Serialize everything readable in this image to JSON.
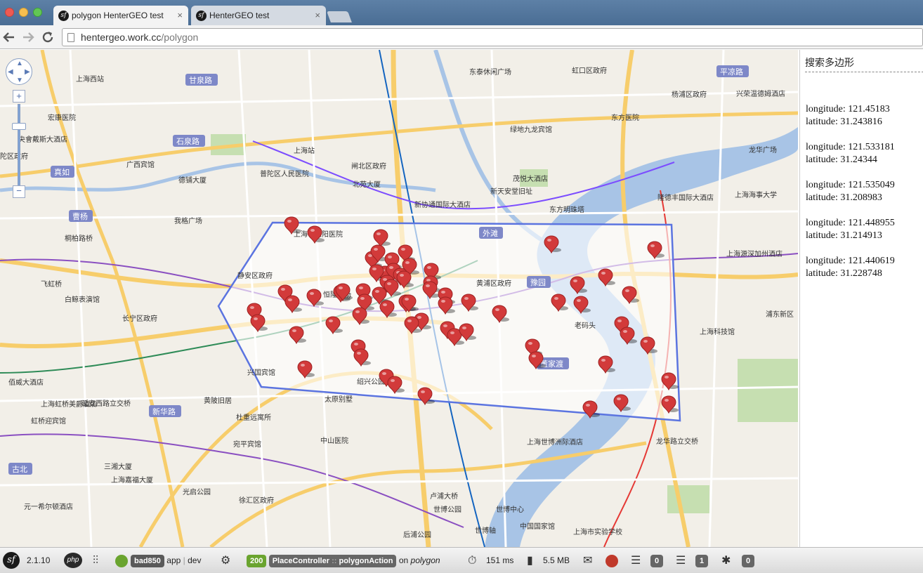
{
  "browser": {
    "tabs": [
      {
        "title": "polygon HenterGEO test",
        "active": true
      },
      {
        "title": "HenterGEO test",
        "active": false
      }
    ],
    "url_host": "hentergeo.work.cc",
    "url_path": "/polygon",
    "tab_favicon_glyph": "sf",
    "tab_close_glyph": "×"
  },
  "map": {
    "road_labels": [
      "甘泉路",
      "石泉路",
      "真如",
      "曹杨",
      "古北",
      "新华路",
      "平凉路",
      "外滩",
      "豫园",
      "董家渡"
    ],
    "place_labels": [
      "上海西站",
      "宏康医院",
      "央會戴斯大酒店",
      "陀区政府",
      "广西宾馆",
      "德铺大厦",
      "普陀区人民医院",
      "上海站",
      "闸北区政府",
      "北苑大厦",
      "东泰休闲广场",
      "虹口区政府",
      "杨浦区政府",
      "兴荣温德姆酒店",
      "绿地九龙宾馆",
      "茂悦大酒店",
      "新天安堂旧址",
      "东方明珠塔",
      "新协通国际大酒店",
      "我格广场",
      "桐柏路桥",
      "上海市江阳医院",
      "静安区政府",
      "长宁区政府",
      "飞虹桥",
      "白鲸表演馆",
      "恒隆广场",
      "兴国宾馆",
      "黄浦区政府",
      "豫园",
      "老码头",
      "绍兴公园",
      "黄陂旧居",
      "太原别墅",
      "杜重远寓所",
      "中山医院",
      "宛平宾馆",
      "三湘大厦",
      "上海嘉福大厦",
      "光启公园",
      "徐汇区政府",
      "元一希尔顿酒店",
      "卢浦大桥",
      "世博公园",
      "世博中心",
      "中国国家馆",
      "世博轴",
      "上海市实验学校",
      "龙华路立交桥",
      "延安西路立交桥",
      "上海虹桥美爵酒店",
      "虹桥迎宾馆",
      "佰威大酒店",
      "隆德丰国际大酒店",
      "上海海事大学",
      "上海源深加州酒店",
      "上海科技馆",
      "浦东新区",
      "龙华广场",
      "上海世博洲际酒店",
      "后浦公园",
      "东方医院"
    ],
    "polygon_color": "#5b74e0",
    "marker_color": "#d23a3a"
  },
  "map_controls": {
    "zoom_in_label": "+",
    "zoom_out_label": "−"
  },
  "panel": {
    "title": "搜索多边形",
    "coordinates": [
      {
        "longitude_label": "longitude: 121.45183",
        "latitude_label": "latitude: 31.243816"
      },
      {
        "longitude_label": "longitude: 121.533181",
        "latitude_label": "latitude: 31.24344"
      },
      {
        "longitude_label": "longitude: 121.535049",
        "latitude_label": "latitude: 31.208983"
      },
      {
        "longitude_label": "longitude: 121.448955",
        "latitude_label": "latitude: 31.214913"
      },
      {
        "longitude_label": "longitude: 121.440619",
        "latitude_label": "latitude: 31.228748"
      }
    ]
  },
  "debugbar": {
    "symfony_version": "2.1.10",
    "php_label": "php",
    "token": "bad850",
    "app_label": "app",
    "env_label": "dev",
    "status_code": "200",
    "controller": "PlaceController",
    "action": "polygonAction",
    "route_prefix": "on",
    "route": "polygon",
    "time": "151 ms",
    "memory": "5.5 MB",
    "db_queries": "0",
    "logs": "1",
    "security_count": "0"
  }
}
